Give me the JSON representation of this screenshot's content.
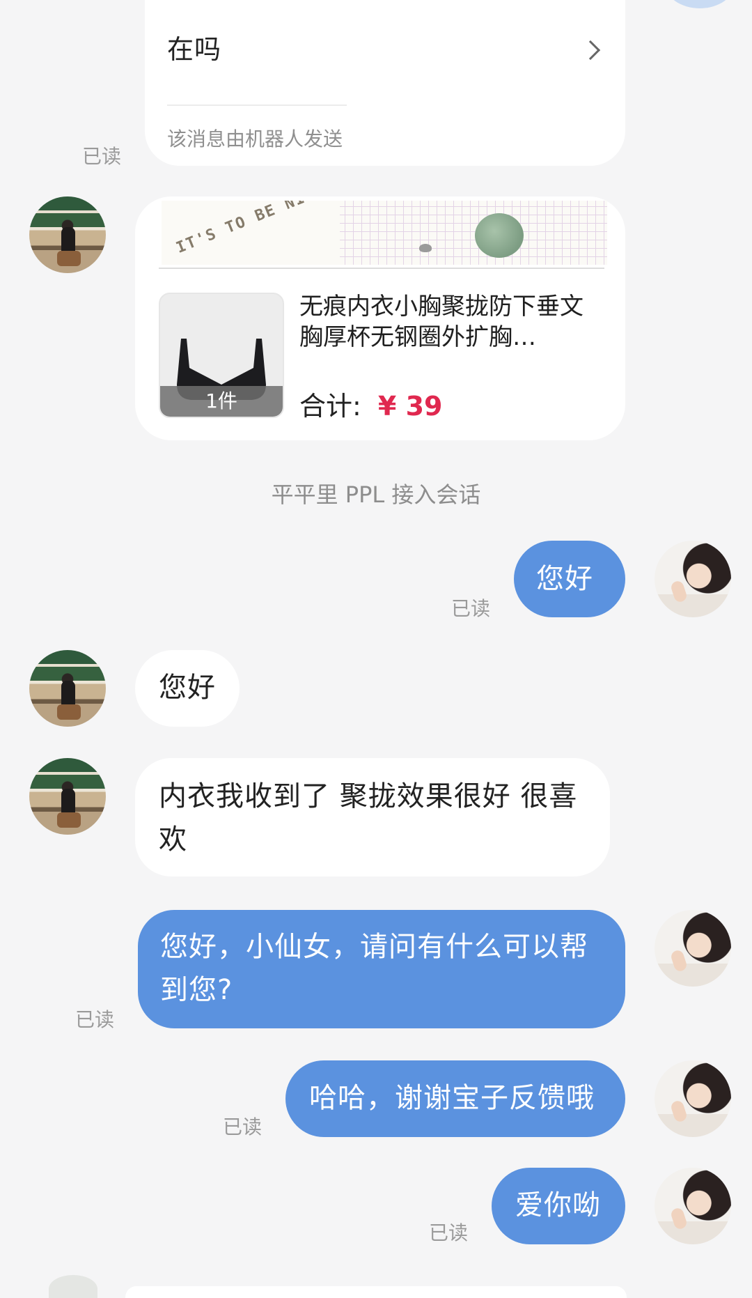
{
  "bot_card": {
    "question": "在吗",
    "footer": "该消息由机器人发送",
    "read_label": "已读"
  },
  "order_card": {
    "banner_text": "IT'S TO BE NICE",
    "product_title": "无痕内衣小胸聚拢防下垂文胸厚杯无钢圈外扩胸…",
    "quantity": "1件",
    "total_label": "合计:",
    "price": "¥ 39",
    "price_color": "#e0284f"
  },
  "system_note": "平平里 PPL 接入会话",
  "messages": [
    {
      "from": "agent",
      "text": "您好",
      "read_label": "已读"
    },
    {
      "from": "customer",
      "text": "您好"
    },
    {
      "from": "customer",
      "text": "内衣我收到了 聚拢效果很好 很喜欢"
    },
    {
      "from": "agent",
      "text": "您好，小仙女，请问有什么可以帮到您?",
      "read_label": "已读"
    },
    {
      "from": "agent",
      "text": "哈哈，谢谢宝子反馈哦",
      "read_label": "已读"
    },
    {
      "from": "agent",
      "text": "爱你呦",
      "read_label": "已读"
    }
  ],
  "colors": {
    "background": "#f5f5f6",
    "agent_bubble": "#5b92df",
    "customer_bubble": "#ffffff"
  }
}
